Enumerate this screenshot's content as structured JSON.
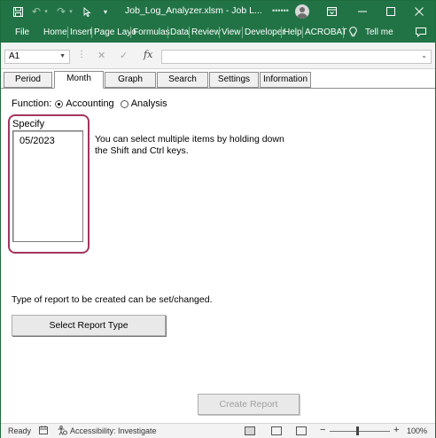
{
  "titlebar": {
    "title": "Job_Log_Analyzer.xlsm  -  Job L...",
    "user": "••••••",
    "icons": [
      "save-icon",
      "undo-icon",
      "redo-icon",
      "pointer-icon",
      "customize-icon",
      "ribbon-display-icon",
      "minimize-icon",
      "maximize-icon",
      "close-icon"
    ],
    "accent": "#217346"
  },
  "ribbon": {
    "tabs": [
      "File",
      "Home",
      "Insert",
      "Page Layo",
      "Formulas",
      "Data",
      "Review",
      "View",
      "Developer",
      "Help",
      "ACROBAT",
      "Tell me"
    ]
  },
  "formula_bar": {
    "name_box": "A1",
    "fx": "fx",
    "formula": ""
  },
  "form": {
    "tabs": [
      "Period",
      "Month",
      "Graph",
      "Search",
      "Settings",
      "Information"
    ],
    "active_tab": "Month",
    "function_label": "Function:",
    "function_options": [
      "Accounting",
      "Analysis"
    ],
    "function_selected": "Accounting",
    "specify_label": "Specify",
    "specify_items": [
      "05/2023"
    ],
    "hint": "You can select multiple items by holding down the Shift and Ctrl keys.",
    "report_note": "Type of report to be created can be set/changed.",
    "select_report_button": "Select Report Type",
    "create_report_button": "Create Report",
    "highlight_color": "#a33560"
  },
  "statusbar": {
    "status": "Ready",
    "accessibility": "Accessibility: Investigate",
    "zoom": "100%",
    "zoom_out": "−",
    "zoom_in": "+"
  }
}
